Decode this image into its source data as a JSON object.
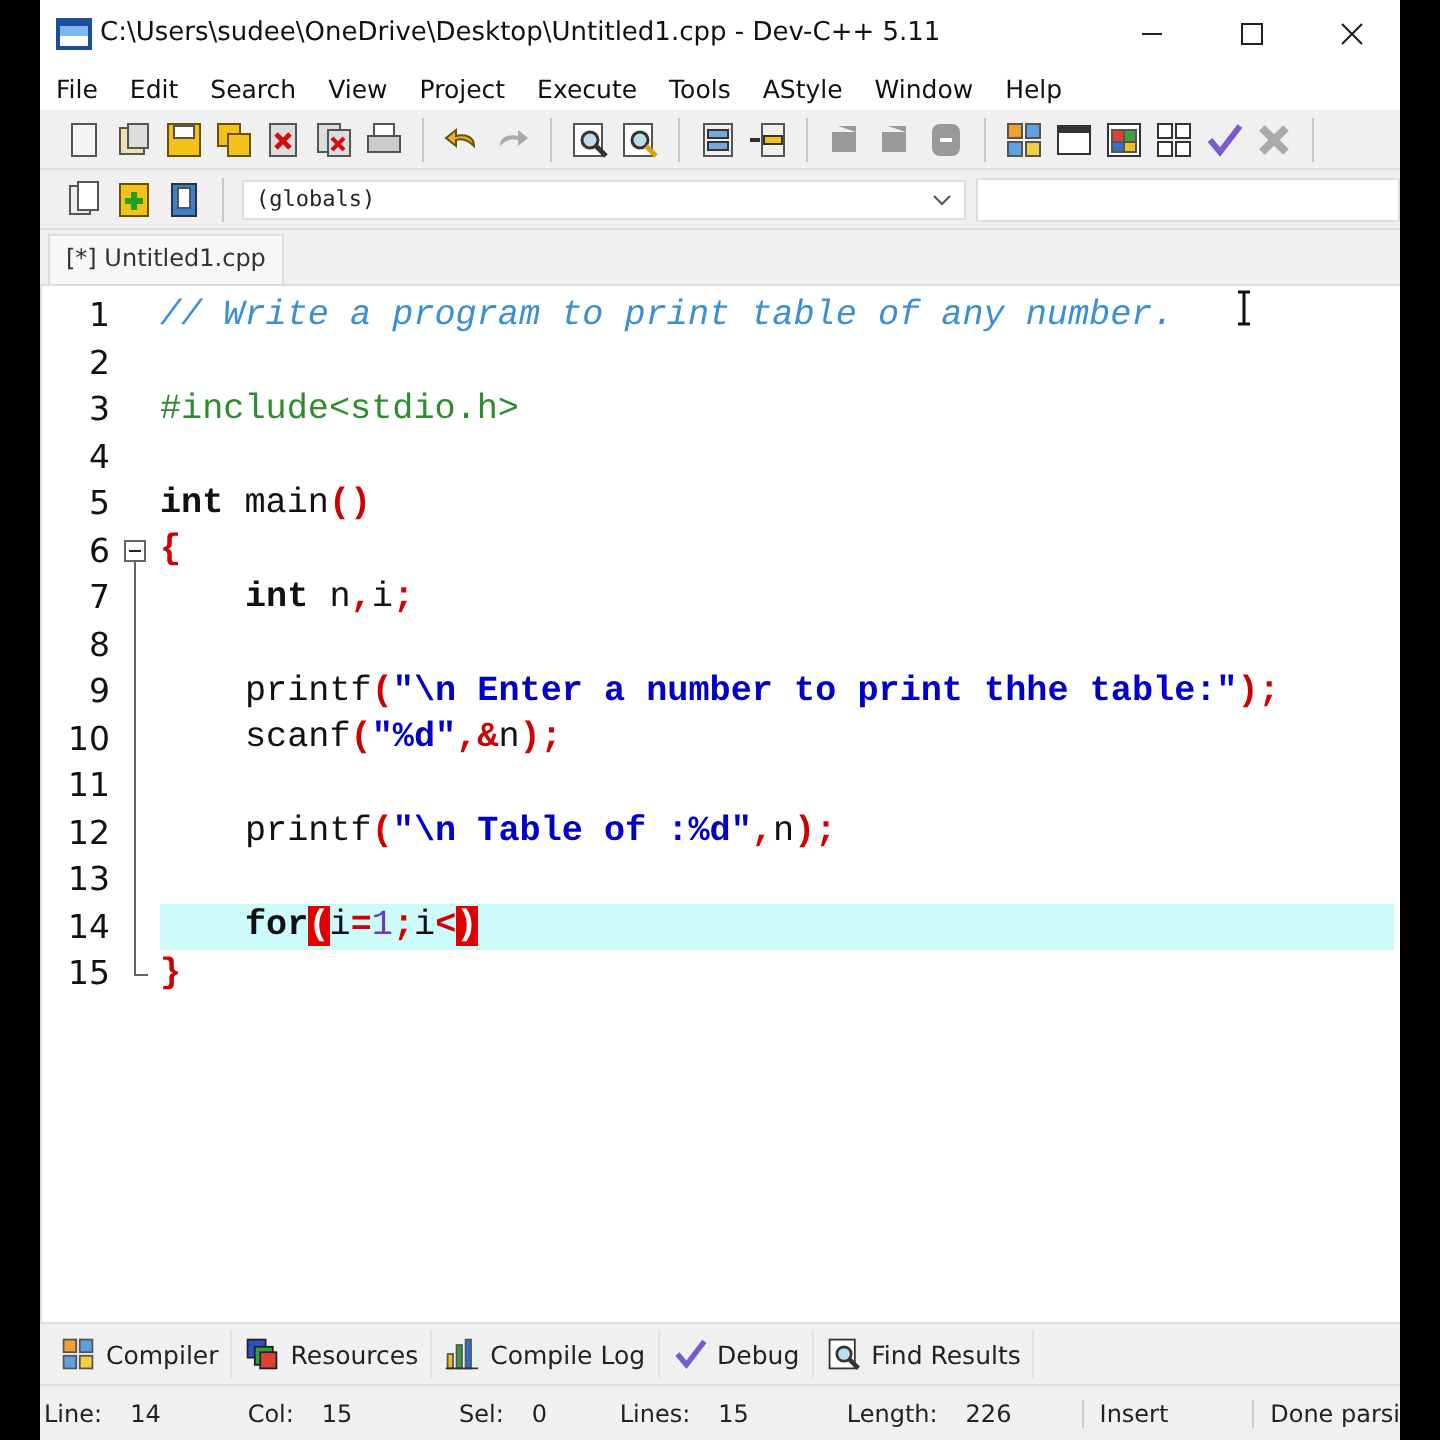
{
  "window": {
    "title": "C:\\Users\\sudee\\OneDrive\\Desktop\\Untitled1.cpp - Dev-C++ 5.11"
  },
  "menu": [
    "File",
    "Edit",
    "Search",
    "View",
    "Project",
    "Execute",
    "Tools",
    "AStyle",
    "Window",
    "Help"
  ],
  "scope_selector": {
    "value": "(globals)"
  },
  "editor_tabs": [
    {
      "label": "[*] Untitled1.cpp",
      "selected": true
    }
  ],
  "code_lines": [
    {
      "number": "1",
      "tokens": [
        {
          "kind": "comment",
          "text": "// Write a program to print table of any number."
        }
      ]
    },
    {
      "number": "2"
    },
    {
      "number": "3",
      "tokens": [
        {
          "kind": "preproc",
          "text": "#include<stdio.h>"
        }
      ]
    },
    {
      "number": "4"
    },
    {
      "number": "5",
      "tokens": [
        {
          "kind": "keyword",
          "text": "int"
        },
        {
          "kind": "ident",
          "text": " main"
        },
        {
          "kind": "symbol",
          "text": "()"
        }
      ]
    },
    {
      "number": "6",
      "expanded": true,
      "tokens": [
        {
          "kind": "symbol",
          "text": "{"
        }
      ],
      "children": [
        {
          "number": "7",
          "indented": true,
          "tokens": [
            {
              "kind": "keyword",
              "text": "int"
            },
            {
              "kind": "ident",
              "text": " n"
            },
            {
              "kind": "symbol",
              "text": ","
            },
            {
              "kind": "ident",
              "text": "i"
            },
            {
              "kind": "symbol",
              "text": ";"
            }
          ]
        },
        {
          "number": "8"
        },
        {
          "number": "9",
          "indented": true,
          "tokens": [
            {
              "kind": "ident",
              "text": "printf"
            },
            {
              "kind": "symbol",
              "text": "("
            },
            {
              "kind": "string",
              "text": "\"\\n Enter a number to print thhe table:\""
            },
            {
              "kind": "symbol",
              "text": ");"
            }
          ]
        },
        {
          "number": "10",
          "indented": true,
          "tokens": [
            {
              "kind": "ident",
              "text": "scanf"
            },
            {
              "kind": "symbol",
              "text": "("
            },
            {
              "kind": "string",
              "text": "\"%d\""
            },
            {
              "kind": "symbol",
              "text": ",&"
            },
            {
              "kind": "ident",
              "text": "n"
            },
            {
              "kind": "symbol",
              "text": ");"
            }
          ]
        },
        {
          "number": "11"
        },
        {
          "number": "12",
          "indented": true,
          "tokens": [
            {
              "kind": "ident",
              "text": "printf"
            },
            {
              "kind": "symbol",
              "text": "("
            },
            {
              "kind": "string",
              "text": "\"\\n Table of :%d\""
            },
            {
              "kind": "symbol",
              "text": ","
            },
            {
              "kind": "ident",
              "text": "n"
            },
            {
              "kind": "symbol",
              "text": ");"
            }
          ]
        },
        {
          "number": "13"
        },
        {
          "number": "14",
          "indented": true,
          "current": true,
          "tokens": [
            {
              "kind": "keyword",
              "text": "for"
            },
            {
              "kind": "bracket",
              "text": "("
            },
            {
              "kind": "ident",
              "text": "i"
            },
            {
              "kind": "symbol",
              "text": "="
            },
            {
              "kind": "number",
              "text": "1"
            },
            {
              "kind": "symbol",
              "text": ";"
            },
            {
              "kind": "ident",
              "text": "i"
            },
            {
              "kind": "symbol",
              "text": "<"
            },
            {
              "kind": "bracket",
              "text": ")"
            }
          ]
        },
        {
          "number": "15",
          "tokens": [
            {
              "kind": "symbol",
              "text": "}"
            }
          ]
        }
      ]
    }
  ],
  "bottom_tabs": [
    "Compiler",
    "Resources",
    "Compile Log",
    "Debug",
    "Find Results"
  ],
  "status_bar": [
    {
      "label": "Line:",
      "value": "14"
    },
    {
      "label": "Col:",
      "value": "15"
    },
    {
      "label": "Sel:",
      "value": "0"
    },
    {
      "label": "Lines:",
      "value": "15"
    },
    {
      "label": "Length:",
      "value": "226"
    },
    {
      "value": "Insert"
    },
    {
      "value": "Done parsi"
    }
  ]
}
